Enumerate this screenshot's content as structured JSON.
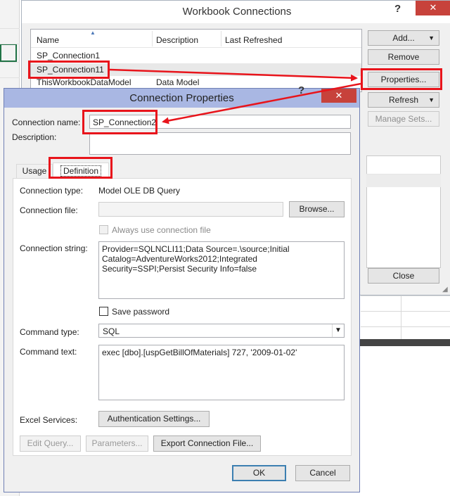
{
  "workbook_connections": {
    "title": "Workbook Connections",
    "help_glyph": "?",
    "close_glyph": "✕",
    "columns": [
      "Name",
      "Description",
      "Last Refreshed"
    ],
    "rows": [
      {
        "name": "SP_Connection1",
        "description": "",
        "last_refreshed": ""
      },
      {
        "name": "SP_Connection11",
        "description": "",
        "last_refreshed": ""
      },
      {
        "name": "ThisWorkbookDataModel",
        "description": "Data Model",
        "last_refreshed": ""
      }
    ],
    "buttons": {
      "add": "Add...",
      "remove": "Remove",
      "properties": "Properties...",
      "refresh": "Refresh",
      "manage_sets": "Manage Sets...",
      "close": "Close"
    }
  },
  "connection_properties": {
    "title": "Connection Properties",
    "help_glyph": "?",
    "close_glyph": "✕",
    "connection_name_label": "Connection name:",
    "connection_name_value": "SP_Connection2",
    "description_label": "Description:",
    "description_value": "",
    "tabs": {
      "usage": "Usage",
      "definition": "Definition"
    },
    "definition": {
      "connection_type_label": "Connection type:",
      "connection_type_value": "Model OLE DB Query",
      "connection_file_label": "Connection file:",
      "connection_file_value": "",
      "browse_button": "Browse...",
      "always_use_file_label": "Always use connection file",
      "always_use_file_checked": false,
      "connection_string_label": "Connection string:",
      "connection_string_value": "Provider=SQLNCLI11;Data Source=.\\source;Initial Catalog=AdventureWorks2012;Integrated Security=SSPI;Persist Security Info=false",
      "save_password_label": "Save password",
      "save_password_checked": false,
      "command_type_label": "Command type:",
      "command_type_value": "SQL",
      "command_text_label": "Command text:",
      "command_text_value": "exec [dbo].[uspGetBillOfMaterials] 727, '2009-01-02'",
      "excel_services_label": "Excel Services:",
      "authentication_button": "Authentication Settings...",
      "edit_query_button": "Edit Query...",
      "parameters_button": "Parameters...",
      "export_button": "Export Connection File..."
    },
    "ok_button": "OK",
    "cancel_button": "Cancel"
  },
  "annotation_color": "#e8141b"
}
